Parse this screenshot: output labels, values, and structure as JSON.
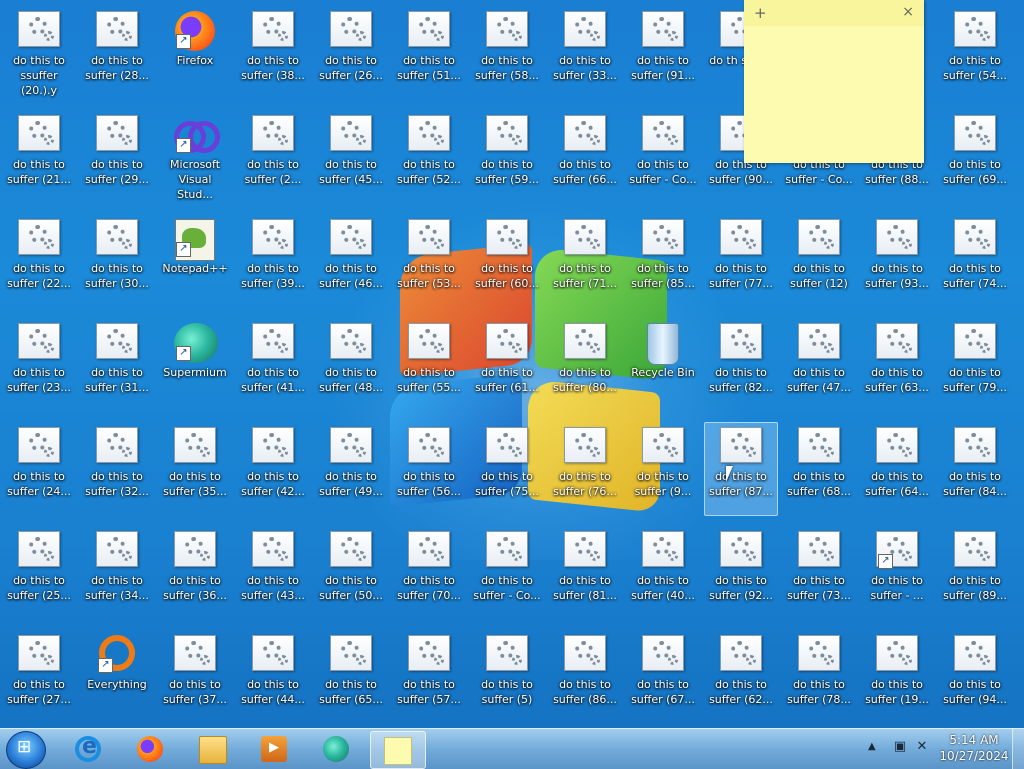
{
  "desktop": {
    "row1": [
      "ssuffer (20.).y",
      "do this to suffer (28...",
      "Firefox",
      "do this to suffer (38...",
      "do this to suffer (26...",
      "do this to suffer (51...",
      "do this to suffer (58...",
      "do this to suffer (33...",
      "do this to suffer (91...",
      "do th suffer",
      "",
      "",
      "do this to suffer (54..."
    ],
    "row1_first_top": "do this to",
    "row2": [
      "do this to suffer (21...",
      "do this to suffer (29...",
      "Microsoft Visual Stud...",
      "do this to suffer (2...",
      "do this to suffer (45...",
      "do this to suffer (52...",
      "do this to suffer (59...",
      "do this to suffer (66...",
      "do this to suffer - Co...",
      "do this to suffer (90...",
      "do this to suffer - Co...",
      "do this to suffer (88...",
      "do this to suffer (69..."
    ],
    "row3": [
      "do this to suffer (22...",
      "do this to suffer (30...",
      "Notepad++",
      "do this to suffer (39...",
      "do this to suffer (46...",
      "do this to suffer (53...",
      "do this to suffer (60...",
      "do this to suffer (71...",
      "do this to suffer (85...",
      "do this to suffer (77...",
      "do this to suffer (12)",
      "do this to suffer (93...",
      "do this to suffer (74..."
    ],
    "row4": [
      "do this to suffer (23...",
      "do this to suffer (31...",
      "Supermium",
      "do this to suffer (41...",
      "do this to suffer (48...",
      "do this to suffer (55...",
      "do this to suffer (61...",
      "do this to suffer (80...",
      "Recycle Bin",
      "do this to suffer (82...",
      "do this to suffer (47...",
      "do this to suffer (63...",
      "do this to suffer (79..."
    ],
    "row5": [
      "do this to suffer (24...",
      "do this to suffer (32...",
      "do this to suffer (35...",
      "do this to suffer (42...",
      "do this to suffer (49...",
      "do this to suffer (56...",
      "do this to suffer (75...",
      "do this to suffer (76...",
      "do this to suffer (9...",
      "do this to suffer (87...",
      "do this to suffer (68...",
      "do this to suffer (64...",
      "do this to suffer (84..."
    ],
    "row6": [
      "do this to suffer (25...",
      "do this to suffer (34...",
      "do this to suffer (36...",
      "do this to suffer (43...",
      "do this to suffer (50...",
      "do this to suffer (70...",
      "do this to suffer - Co...",
      "do this to suffer (81...",
      "do this to suffer (40...",
      "do this to suffer (92...",
      "do this to suffer (73...",
      "do this to suffer - ...",
      "do this to suffer (89..."
    ],
    "row7": [
      "do this to suffer (27...",
      "Everything",
      "do this to suffer (37...",
      "do this to suffer (44...",
      "do this to suffer (65...",
      "do this to suffer (57...",
      "do this to suffer (5)",
      "do this to suffer (86...",
      "do this to suffer (67...",
      "do this to suffer (62...",
      "do this to suffer (78...",
      "do this to suffer (19...",
      "do this to suffer (94..."
    ]
  },
  "sticky_note": {
    "add_glyph": "+",
    "close_glyph": "×",
    "body": ""
  },
  "taskbar": {
    "clock_time": "5:14 AM",
    "clock_date": "10/27/2024",
    "tray_up_glyph": "▲",
    "pinned": [
      "internet-explorer",
      "firefox",
      "windows-explorer",
      "windows-media-player",
      "supermium",
      "sticky-notes"
    ]
  }
}
